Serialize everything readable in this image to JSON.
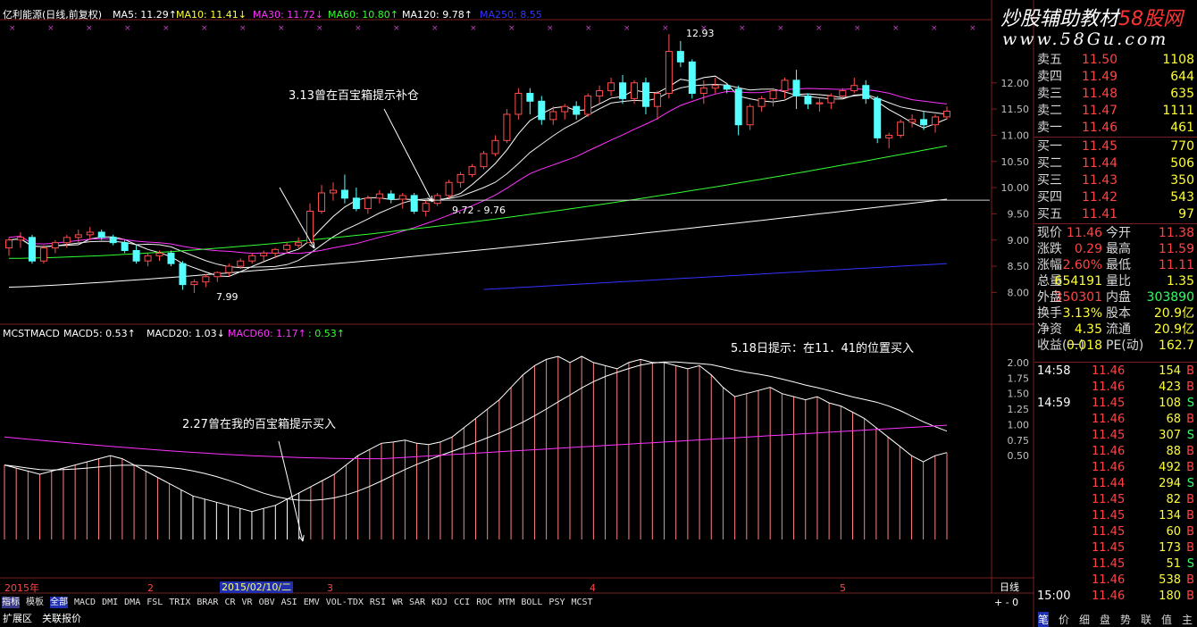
{
  "colors": {
    "up": "#ff4d4d",
    "down": "#54ffff",
    "ma5": "#ffffff",
    "ma10": "#ffff33",
    "ma30": "#ff33ff",
    "ma60": "#33ff33",
    "ma120": "#ffffff",
    "ma250": "#3333ff",
    "macd_bar": "#ff8080",
    "frame": "#7a1f1f",
    "text": "#c0c0c0",
    "price_red": "#ff4444",
    "green": "#33ff66"
  },
  "header": {
    "title": "亿利能源(日线,前复权)",
    "ma5": "MA5: 11.29↑",
    "ma10": "MA10: 11.41↓",
    "ma30": "MA30: 11.72↓",
    "ma60": "MA60: 10.80↑",
    "ma120": "MA120: 9.78↑",
    "ma250": "MA250: 8.55"
  },
  "watermark": {
    "line1": "炒股辅助教材",
    "line1b": "58股网",
    "line2": "www.58Gu.com"
  },
  "chart_data": {
    "type": "candlestick",
    "price_axis": {
      "ticks": [
        "12.00",
        "11.50",
        "11.00",
        "10.50",
        "10.00",
        "9.50",
        "9.00",
        "8.50",
        "8.00"
      ],
      "ylim": [
        7.7,
        12.9
      ]
    },
    "macd_axis": {
      "ticks": [
        "2.00",
        "1.75",
        "1.50",
        "1.25",
        "1.00",
        "0.75",
        "0.50"
      ],
      "ylim": [
        -0.85,
        2.2
      ]
    },
    "high_label": "12.93",
    "low_label": "7.99",
    "range_label": "9.72 - 9.76",
    "candles": [
      {
        "o": 8.85,
        "h": 9.05,
        "l": 8.7,
        "c": 9.0
      },
      {
        "o": 9.0,
        "h": 9.15,
        "l": 8.85,
        "c": 9.05
      },
      {
        "o": 9.05,
        "h": 9.1,
        "l": 8.55,
        "c": 8.6
      },
      {
        "o": 8.6,
        "h": 8.9,
        "l": 8.55,
        "c": 8.85
      },
      {
        "o": 8.85,
        "h": 9.0,
        "l": 8.75,
        "c": 8.95
      },
      {
        "o": 8.95,
        "h": 9.1,
        "l": 8.85,
        "c": 9.05
      },
      {
        "o": 9.05,
        "h": 9.2,
        "l": 8.95,
        "c": 9.1
      },
      {
        "o": 9.1,
        "h": 9.25,
        "l": 9.0,
        "c": 9.15
      },
      {
        "o": 9.15,
        "h": 9.2,
        "l": 9.0,
        "c": 9.05
      },
      {
        "o": 9.05,
        "h": 9.1,
        "l": 8.9,
        "c": 8.95
      },
      {
        "o": 8.95,
        "h": 9.0,
        "l": 8.75,
        "c": 8.8
      },
      {
        "o": 8.8,
        "h": 8.9,
        "l": 8.55,
        "c": 8.6
      },
      {
        "o": 8.6,
        "h": 8.75,
        "l": 8.5,
        "c": 8.7
      },
      {
        "o": 8.7,
        "h": 8.8,
        "l": 8.6,
        "c": 8.75
      },
      {
        "o": 8.75,
        "h": 8.8,
        "l": 8.5,
        "c": 8.55
      },
      {
        "o": 8.55,
        "h": 8.6,
        "l": 8.05,
        "c": 8.15
      },
      {
        "o": 8.15,
        "h": 8.25,
        "l": 7.99,
        "c": 8.2
      },
      {
        "o": 8.2,
        "h": 8.35,
        "l": 8.1,
        "c": 8.3
      },
      {
        "o": 8.3,
        "h": 8.4,
        "l": 8.2,
        "c": 8.38
      },
      {
        "o": 8.38,
        "h": 8.55,
        "l": 8.3,
        "c": 8.5
      },
      {
        "o": 8.5,
        "h": 8.65,
        "l": 8.45,
        "c": 8.6
      },
      {
        "o": 8.6,
        "h": 8.75,
        "l": 8.55,
        "c": 8.7
      },
      {
        "o": 8.7,
        "h": 8.8,
        "l": 8.6,
        "c": 8.75
      },
      {
        "o": 8.75,
        "h": 8.85,
        "l": 8.65,
        "c": 8.82
      },
      {
        "o": 8.82,
        "h": 8.95,
        "l": 8.75,
        "c": 8.9
      },
      {
        "o": 8.9,
        "h": 9.05,
        "l": 8.85,
        "c": 8.95
      },
      {
        "o": 8.95,
        "h": 9.7,
        "l": 8.95,
        "c": 9.55
      },
      {
        "o": 9.55,
        "h": 10.05,
        "l": 9.5,
        "c": 9.9
      },
      {
        "o": 9.9,
        "h": 10.1,
        "l": 9.75,
        "c": 9.95
      },
      {
        "o": 9.95,
        "h": 10.25,
        "l": 9.7,
        "c": 9.8
      },
      {
        "o": 9.8,
        "h": 10.0,
        "l": 9.55,
        "c": 9.6
      },
      {
        "o": 9.6,
        "h": 9.85,
        "l": 9.5,
        "c": 9.8
      },
      {
        "o": 9.8,
        "h": 9.95,
        "l": 9.7,
        "c": 9.88
      },
      {
        "o": 9.88,
        "h": 9.95,
        "l": 9.7,
        "c": 9.78
      },
      {
        "o": 9.78,
        "h": 9.9,
        "l": 9.6,
        "c": 9.85
      },
      {
        "o": 9.85,
        "h": 9.9,
        "l": 9.5,
        "c": 9.55
      },
      {
        "o": 9.55,
        "h": 9.75,
        "l": 9.45,
        "c": 9.7
      },
      {
        "o": 9.7,
        "h": 9.9,
        "l": 9.65,
        "c": 9.85
      },
      {
        "o": 9.85,
        "h": 10.15,
        "l": 9.8,
        "c": 10.1
      },
      {
        "o": 10.1,
        "h": 10.3,
        "l": 10.0,
        "c": 10.25
      },
      {
        "o": 10.25,
        "h": 10.45,
        "l": 10.2,
        "c": 10.4
      },
      {
        "o": 10.4,
        "h": 10.7,
        "l": 10.35,
        "c": 10.65
      },
      {
        "o": 10.65,
        "h": 11.0,
        "l": 10.6,
        "c": 10.9
      },
      {
        "o": 10.9,
        "h": 11.5,
        "l": 10.85,
        "c": 11.4
      },
      {
        "o": 11.4,
        "h": 11.9,
        "l": 11.3,
        "c": 11.8
      },
      {
        "o": 11.8,
        "h": 11.9,
        "l": 11.4,
        "c": 11.65
      },
      {
        "o": 11.65,
        "h": 11.75,
        "l": 11.2,
        "c": 11.3
      },
      {
        "o": 11.3,
        "h": 11.55,
        "l": 11.2,
        "c": 11.45
      },
      {
        "o": 11.45,
        "h": 11.6,
        "l": 11.3,
        "c": 11.55
      },
      {
        "o": 11.55,
        "h": 11.65,
        "l": 11.3,
        "c": 11.4
      },
      {
        "o": 11.4,
        "h": 11.8,
        "l": 11.35,
        "c": 11.75
      },
      {
        "o": 11.75,
        "h": 11.95,
        "l": 11.6,
        "c": 11.85
      },
      {
        "o": 11.85,
        "h": 12.1,
        "l": 11.75,
        "c": 12.0
      },
      {
        "o": 12.0,
        "h": 12.15,
        "l": 11.6,
        "c": 11.7
      },
      {
        "o": 11.7,
        "h": 12.05,
        "l": 11.6,
        "c": 12.0
      },
      {
        "o": 12.0,
        "h": 12.1,
        "l": 11.4,
        "c": 11.55
      },
      {
        "o": 11.55,
        "h": 11.85,
        "l": 11.3,
        "c": 11.8
      },
      {
        "o": 11.8,
        "h": 12.93,
        "l": 11.7,
        "c": 12.6
      },
      {
        "o": 12.6,
        "h": 12.8,
        "l": 12.3,
        "c": 12.4
      },
      {
        "o": 12.4,
        "h": 12.45,
        "l": 11.7,
        "c": 11.8
      },
      {
        "o": 11.8,
        "h": 12.05,
        "l": 11.6,
        "c": 11.9
      },
      {
        "o": 11.9,
        "h": 12.1,
        "l": 11.8,
        "c": 11.95
      },
      {
        "o": 11.95,
        "h": 12.0,
        "l": 11.8,
        "c": 11.88
      },
      {
        "o": 11.88,
        "h": 11.95,
        "l": 11.0,
        "c": 11.2
      },
      {
        "o": 11.2,
        "h": 11.6,
        "l": 11.1,
        "c": 11.55
      },
      {
        "o": 11.55,
        "h": 11.75,
        "l": 11.45,
        "c": 11.7
      },
      {
        "o": 11.7,
        "h": 11.9,
        "l": 11.55,
        "c": 11.85
      },
      {
        "o": 11.85,
        "h": 12.1,
        "l": 11.7,
        "c": 12.05
      },
      {
        "o": 12.05,
        "h": 12.25,
        "l": 11.5,
        "c": 11.75
      },
      {
        "o": 11.75,
        "h": 11.8,
        "l": 11.5,
        "c": 11.6
      },
      {
        "o": 11.6,
        "h": 11.7,
        "l": 11.45,
        "c": 11.62
      },
      {
        "o": 11.62,
        "h": 11.8,
        "l": 11.5,
        "c": 11.75
      },
      {
        "o": 11.75,
        "h": 11.9,
        "l": 11.7,
        "c": 11.85
      },
      {
        "o": 11.85,
        "h": 12.1,
        "l": 11.8,
        "c": 11.95
      },
      {
        "o": 11.95,
        "h": 12.05,
        "l": 11.6,
        "c": 11.7
      },
      {
        "o": 11.7,
        "h": 11.75,
        "l": 10.85,
        "c": 10.95
      },
      {
        "o": 10.95,
        "h": 11.05,
        "l": 10.75,
        "c": 11.0
      },
      {
        "o": 11.0,
        "h": 11.3,
        "l": 10.95,
        "c": 11.25
      },
      {
        "o": 11.25,
        "h": 11.4,
        "l": 11.15,
        "c": 11.3
      },
      {
        "o": 11.3,
        "h": 11.45,
        "l": 11.1,
        "c": 11.2
      },
      {
        "o": 11.2,
        "h": 11.4,
        "l": 11.05,
        "c": 11.35
      },
      {
        "o": 11.35,
        "h": 11.55,
        "l": 11.3,
        "c": 11.46
      }
    ],
    "macd": [
      0.35,
      0.3,
      0.25,
      0.2,
      0.25,
      0.3,
      0.35,
      0.4,
      0.45,
      0.5,
      0.45,
      0.35,
      0.25,
      0.15,
      0.05,
      -0.05,
      -0.15,
      -0.2,
      -0.25,
      -0.3,
      -0.35,
      -0.4,
      -0.35,
      -0.3,
      -0.2,
      -0.1,
      0.0,
      0.1,
      0.2,
      0.35,
      0.5,
      0.6,
      0.7,
      0.72,
      0.75,
      0.7,
      0.68,
      0.72,
      0.8,
      0.95,
      1.1,
      1.25,
      1.4,
      1.6,
      1.8,
      1.95,
      2.05,
      2.1,
      2.0,
      2.1,
      2.0,
      1.95,
      1.9,
      2.0,
      2.05,
      2.0,
      2.0,
      1.95,
      1.9,
      1.95,
      1.8,
      1.6,
      1.45,
      1.5,
      1.55,
      1.6,
      1.5,
      1.45,
      1.4,
      1.45,
      1.35,
      1.3,
      1.2,
      1.1,
      0.95,
      0.8,
      0.65,
      0.5,
      0.4,
      0.5,
      0.55
    ],
    "macd_labels": {
      "name": "MCSTMACD",
      "m5": "MACD5: 0.53↑",
      "m20": "MACD20: 1.03↓",
      "m60": "MACD60: 1.17↑",
      "val": ": 0.53↑"
    }
  },
  "annotations": {
    "a1": "3.13曾在百宝箱提示补仓",
    "a2": "2.27曾在我的百宝箱提示买入",
    "a3": "5.18日提示：在11．41的位置买入"
  },
  "date_axis": {
    "year": "2015年",
    "m2": "2",
    "cursor": "2015/02/10/二",
    "m3": "3",
    "m4": "4",
    "m5": "5",
    "period": "日线"
  },
  "tabs": [
    "指标",
    "模板",
    "全部",
    "MACD",
    "DMI",
    "DMA",
    "FSL",
    "TRIX",
    "BRAR",
    "CR",
    "VR",
    "OBV",
    "ASI",
    "EMV",
    "VOL-TDX",
    "RSI",
    "WR",
    "SAR",
    "KDJ",
    "CCI",
    "ROC",
    "MTM",
    "BOLL",
    "PSY",
    "MCST"
  ],
  "bottom": {
    "ext": "扩展区",
    "quote": "关联报价"
  },
  "scroll": "+  -  0",
  "order_book": {
    "sell": [
      {
        "l": "卖五",
        "p": "11.50",
        "v": "1108"
      },
      {
        "l": "卖四",
        "p": "11.49",
        "v": "644"
      },
      {
        "l": "卖三",
        "p": "11.48",
        "v": "635"
      },
      {
        "l": "卖二",
        "p": "11.47",
        "v": "1111"
      },
      {
        "l": "卖一",
        "p": "11.46",
        "v": "461"
      }
    ],
    "buy": [
      {
        "l": "买一",
        "p": "11.45",
        "v": "770"
      },
      {
        "l": "买二",
        "p": "11.44",
        "v": "506"
      },
      {
        "l": "买三",
        "p": "11.43",
        "v": "350"
      },
      {
        "l": "买四",
        "p": "11.42",
        "v": "543"
      },
      {
        "l": "买五",
        "p": "11.41",
        "v": "97"
      }
    ]
  },
  "stats": [
    {
      "l1": "现价",
      "v1": "11.46",
      "l2": "今开",
      "v2": "11.38"
    },
    {
      "l1": "涨跌",
      "v1": "0.29",
      "l2": "最高",
      "v2": "11.59"
    },
    {
      "l1": "涨幅",
      "v1": "2.60%",
      "l2": "最低",
      "v2": "11.11"
    },
    {
      "l1": "总量",
      "v1": "654191",
      "l2": "量比",
      "v2": "1.35"
    },
    {
      "l1": "外盘",
      "v1": "350301",
      "l2": "内盘",
      "v2": "303890"
    },
    {
      "l1": "换手",
      "v1": "3.13%",
      "l2": "股本",
      "v2": "20.9亿"
    },
    {
      "l1": "净资",
      "v1": "4.35",
      "l2": "流通",
      "v2": "20.9亿"
    },
    {
      "l1": "收益(一)",
      "v1": "0.018",
      "l2": "PE(动)",
      "v2": "162.7"
    }
  ],
  "ticks": [
    {
      "t": "14:58",
      "p": "11.46",
      "v": "154",
      "s": "B"
    },
    {
      "t": "",
      "p": "11.46",
      "v": "423",
      "s": "B"
    },
    {
      "t": "14:59",
      "p": "11.45",
      "v": "108",
      "s": "S"
    },
    {
      "t": "",
      "p": "11.46",
      "v": "68",
      "s": "B"
    },
    {
      "t": "",
      "p": "11.45",
      "v": "307",
      "s": "S"
    },
    {
      "t": "",
      "p": "11.46",
      "v": "88",
      "s": "B"
    },
    {
      "t": "",
      "p": "11.46",
      "v": "492",
      "s": "B"
    },
    {
      "t": "",
      "p": "11.44",
      "v": "294",
      "s": "S"
    },
    {
      "t": "",
      "p": "11.45",
      "v": "82",
      "s": "B"
    },
    {
      "t": "",
      "p": "11.45",
      "v": "134",
      "s": "B"
    },
    {
      "t": "",
      "p": "11.45",
      "v": "60",
      "s": "B"
    },
    {
      "t": "",
      "p": "11.45",
      "v": "173",
      "s": "B"
    },
    {
      "t": "",
      "p": "11.45",
      "v": "51",
      "s": "S"
    },
    {
      "t": "",
      "p": "11.46",
      "v": "538",
      "s": "B"
    },
    {
      "t": "15:00",
      "p": "11.46",
      "v": "180",
      "s": "B"
    }
  ],
  "right_tabs": [
    "笔",
    "价",
    "细",
    "盘",
    "势",
    "联",
    "值",
    "主"
  ]
}
